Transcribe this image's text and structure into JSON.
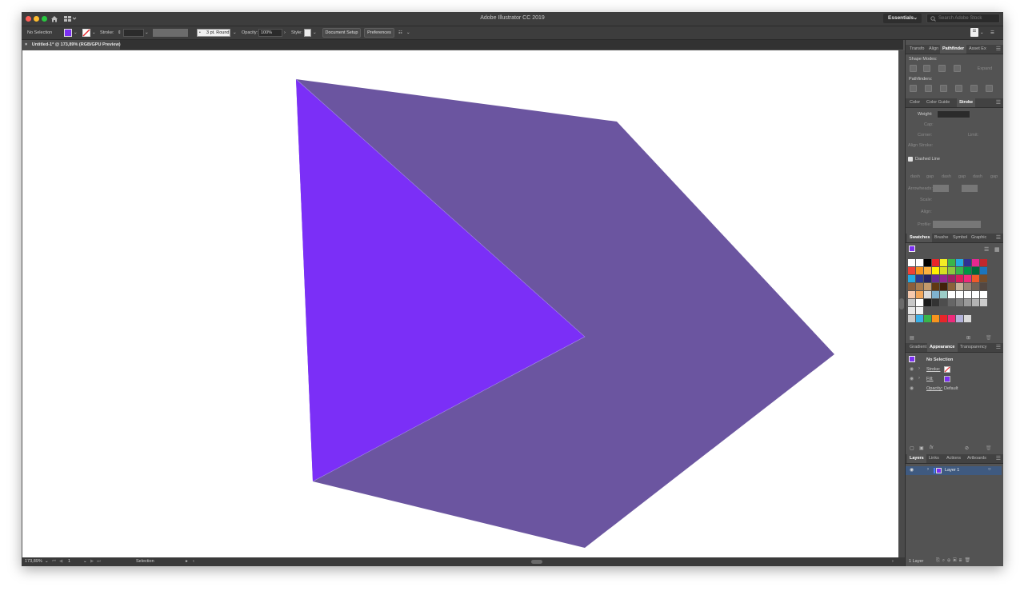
{
  "app": {
    "title": "Adobe Illustrator CC 2019",
    "workspace": "Essentials",
    "search_placeholder": "Search Adobe Stock"
  },
  "control_bar": {
    "selection_label": "No Selection",
    "stroke_label": "Stroke:",
    "brush_value": "3 pt. Round",
    "opacity_label": "Opacity:",
    "opacity_value": "100%",
    "style_label": "Style:",
    "document_setup": "Document Setup",
    "preferences": "Preferences",
    "fill_color": "#7b2ff2"
  },
  "document_tab": {
    "close": "×",
    "label": "Untitled-1* @ 173,89% (RGB/GPU Preview)"
  },
  "artwork": {
    "back_shape_color": "#6b55a0",
    "front_shape_color": "#7b2ff7"
  },
  "status": {
    "zoom": "173,89%",
    "artboard": "1",
    "tool": "Selection"
  },
  "panels": {
    "top_tabs": [
      "Transfo",
      "Align",
      "Pathfinder",
      "Asset Ex"
    ],
    "shape_modes": "Shape Modes:",
    "expand": "Expand",
    "pathfinders": "Pathfinders:",
    "stroke_tabs": [
      "Color",
      "Color Guide",
      "Stroke"
    ],
    "weight": "Weight:",
    "cap": "Cap:",
    "corner": "Corner:",
    "limit": "Limit:",
    "align_stroke": "Align Stroke:",
    "dashed_line": "Dashed Line",
    "dash_labels": [
      "dash",
      "gap",
      "dash",
      "gap",
      "dash",
      "gap"
    ],
    "arrowheads": "Arrowheads:",
    "scale": "Scale:",
    "align": "Align:",
    "profile": "Profile:",
    "swatch_tabs": [
      "Swatches",
      "Brushe",
      "Symbol",
      "Graphic"
    ],
    "appearance_tabs": [
      "Gradient",
      "Appearance",
      "Transparency"
    ],
    "no_selection": "No Selection",
    "stroke_row": "Stroke:",
    "fill_row": "Fill:",
    "opacity_row": "Opacity:",
    "opacity_default": "Default",
    "layer_tabs": [
      "Layers",
      "Links",
      "Actions",
      "Artboards"
    ],
    "layer_name": "Layer 1",
    "layers_count": "1 Layer"
  },
  "swatch_rows": [
    [
      "#ffffff",
      "#ffffff",
      "#000000",
      "#e8262a",
      "#f4ec24",
      "#3ab54a",
      "#26a9e0",
      "#2e3192",
      "#e6278f",
      "#c1272d"
    ],
    [
      "#ef4136",
      "#f7941d",
      "#fbb040",
      "#fff200",
      "#d7e021",
      "#8dc63f",
      "#39b54a",
      "#009444",
      "#006838",
      "#1c75bc"
    ],
    [
      "#27aae1",
      "#2b3990",
      "#262262",
      "#662d91",
      "#92278f",
      "#9e1f63",
      "#da1c5c",
      "#ee2a7b",
      "#f15a29",
      "#754c29"
    ],
    [
      "#8b5e3c",
      "#a97c50",
      "#c49a6c",
      "#603913",
      "#42210b",
      "#8c6239",
      "#c7b299",
      "#998675",
      "#736357",
      "#534741"
    ],
    [
      "#f6c9ad",
      "#f2a65a",
      "#d9d9d9",
      "#7fb2d0",
      "#9ccdc8",
      "#ffffff",
      "#ffffff",
      "#ffffff",
      "#ffffff",
      "#ffffff"
    ],
    [
      "#c8c8c8",
      "#ffffff",
      "#1a1a1a",
      "#333333",
      "#4d4d4d",
      "#666666",
      "#808080",
      "#999999",
      "#b3b3b3",
      "#cccccc"
    ],
    [
      "#e6e6e6",
      "#f2f2f2"
    ],
    [
      "#c9c9c9",
      "#3ab0e8",
      "#39b54a",
      "#f7941d",
      "#e8262a",
      "#ee2a7b",
      "#b3b3d9",
      "#d9d9d9"
    ]
  ]
}
